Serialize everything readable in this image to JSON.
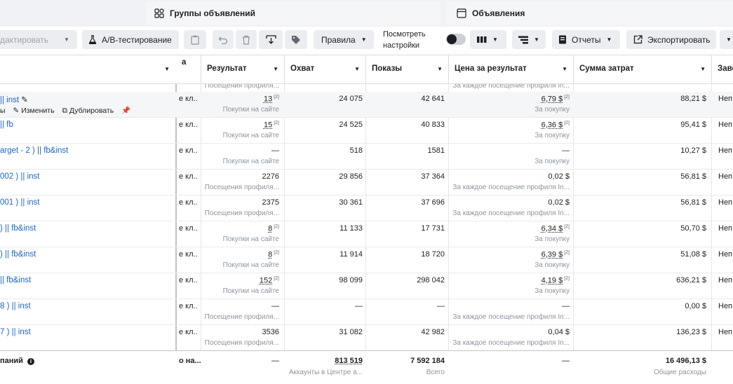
{
  "tabs": {
    "groups_label": "Группы объявлений",
    "ads_label": "Объявления"
  },
  "toolbar": {
    "edit_label": "дактировать",
    "ab_label": "A/B-тестирование",
    "rules_label": "Правила",
    "view_settings_line1": "Посмотреть",
    "view_settings_line2": "настройки",
    "reports_label": "Отчеты",
    "export_label": "Экспортировать"
  },
  "columns": {
    "name_header": "",
    "cut_header": "а",
    "result": "Результат",
    "reach": "Охват",
    "impressions": "Показы",
    "cost_per_result": "Цена за результат",
    "amount_spent": "Сумма затрат",
    "delivery": "Заве"
  },
  "partial_row": {
    "result_sub": "Посещения профиля...",
    "cost_sub": "За каждое посещение профиля In..."
  },
  "row_actions": {
    "charts": "ы",
    "edit": "Изменить",
    "duplicate": "Дублировать"
  },
  "rows": [
    {
      "name": "|| inst",
      "cut": "е кл...",
      "result": "13",
      "result_sub": "Покупки на сайте",
      "reach": "24 075",
      "impressions": "42 641",
      "cost": "6,79 $",
      "cost_sub": "За покупку",
      "spent": "88,21 $",
      "delivery": "Неп"
    },
    {
      "name": "|| fb",
      "cut": "е кл...",
      "result": "15",
      "result_sub": "Покупки на сайте",
      "reach": "24 525",
      "impressions": "40 833",
      "cost": "6,36 $",
      "cost_sub": "За покупку",
      "spent": "95,41 $",
      "delivery": "Неп"
    },
    {
      "name": "arget - 2 ) || fb&inst",
      "cut": "е кл...",
      "result": "—",
      "result_sub": "Покупки на сайте",
      "reach": "518",
      "impressions": "1581",
      "cost": "—",
      "cost_sub": "За покупку",
      "spent": "10,27 $",
      "delivery": "Неп"
    },
    {
      "name": "002 ) || inst",
      "cut": "е кл...",
      "result": "2276",
      "result_sub": "Посещения профиля...",
      "reach": "29 856",
      "impressions": "37 364",
      "cost": "0,02 $",
      "cost_sub": "За каждое посещение профиля In...",
      "spent": "56,81 $",
      "delivery": "Неп"
    },
    {
      "name": "001 ) || inst",
      "cut": "е кл...",
      "result": "2375",
      "result_sub": "Посещения профиля...",
      "reach": "30 361",
      "impressions": "37 696",
      "cost": "0,02 $",
      "cost_sub": "За каждое посещение профиля In...",
      "spent": "56,81 $",
      "delivery": "Неп"
    },
    {
      "name": ") || fb&inst",
      "cut": "е кл...",
      "result": "8",
      "result_sub": "Покупки на сайте",
      "reach": "11 133",
      "impressions": "17 731",
      "cost": "6,34 $",
      "cost_sub": "За покупку",
      "spent": "50,70 $",
      "delivery": "Неп"
    },
    {
      "name": ") || fb&inst",
      "cut": "е кл...",
      "result": "8",
      "result_sub": "Покупки на сайте",
      "reach": "11 914",
      "impressions": "18 720",
      "cost": "6,39 $",
      "cost_sub": "За покупку",
      "spent": "51,08 $",
      "delivery": "Неп"
    },
    {
      "name": "|| fb&inst",
      "cut": "е кл...",
      "result": "152",
      "result_sub": "Покупки на сайте",
      "reach": "98 099",
      "impressions": "298 042",
      "cost": "4,19 $",
      "cost_sub": "За покупку",
      "spent": "636,21 $",
      "delivery": "Неп"
    },
    {
      "name": "8 ) || inst",
      "cut": "е кл...",
      "result": "—",
      "result_sub": "Посещение профиля...",
      "reach": "—",
      "impressions": "—",
      "cost": "—",
      "cost_sub": "За каждое посещение профиля In...",
      "spent": "0,00 $",
      "delivery": "Неп"
    },
    {
      "name": "7 ) || inst",
      "cut": "е кл...",
      "result": "3536",
      "result_sub": "Посещения профиля...",
      "reach": "31 082",
      "impressions": "42 982",
      "cost": "0,04 $",
      "cost_sub": "За каждое посещение профиля In...",
      "spent": "136,23 $",
      "delivery": "Неп"
    }
  ],
  "totals": {
    "label": "паний",
    "cut": "о на...",
    "result": "—",
    "reach": "813 519",
    "reach_sub": "Аккаунты в Центре а...",
    "impressions": "7 592 184",
    "impressions_sub": "Всего",
    "cost": "—",
    "spent": "16 496,13 $",
    "spent_sub": "Общие расходы"
  },
  "colors": {
    "link": "#1a66c9",
    "muted": "#8d949e",
    "toolbar_button": "#ebedf0"
  }
}
